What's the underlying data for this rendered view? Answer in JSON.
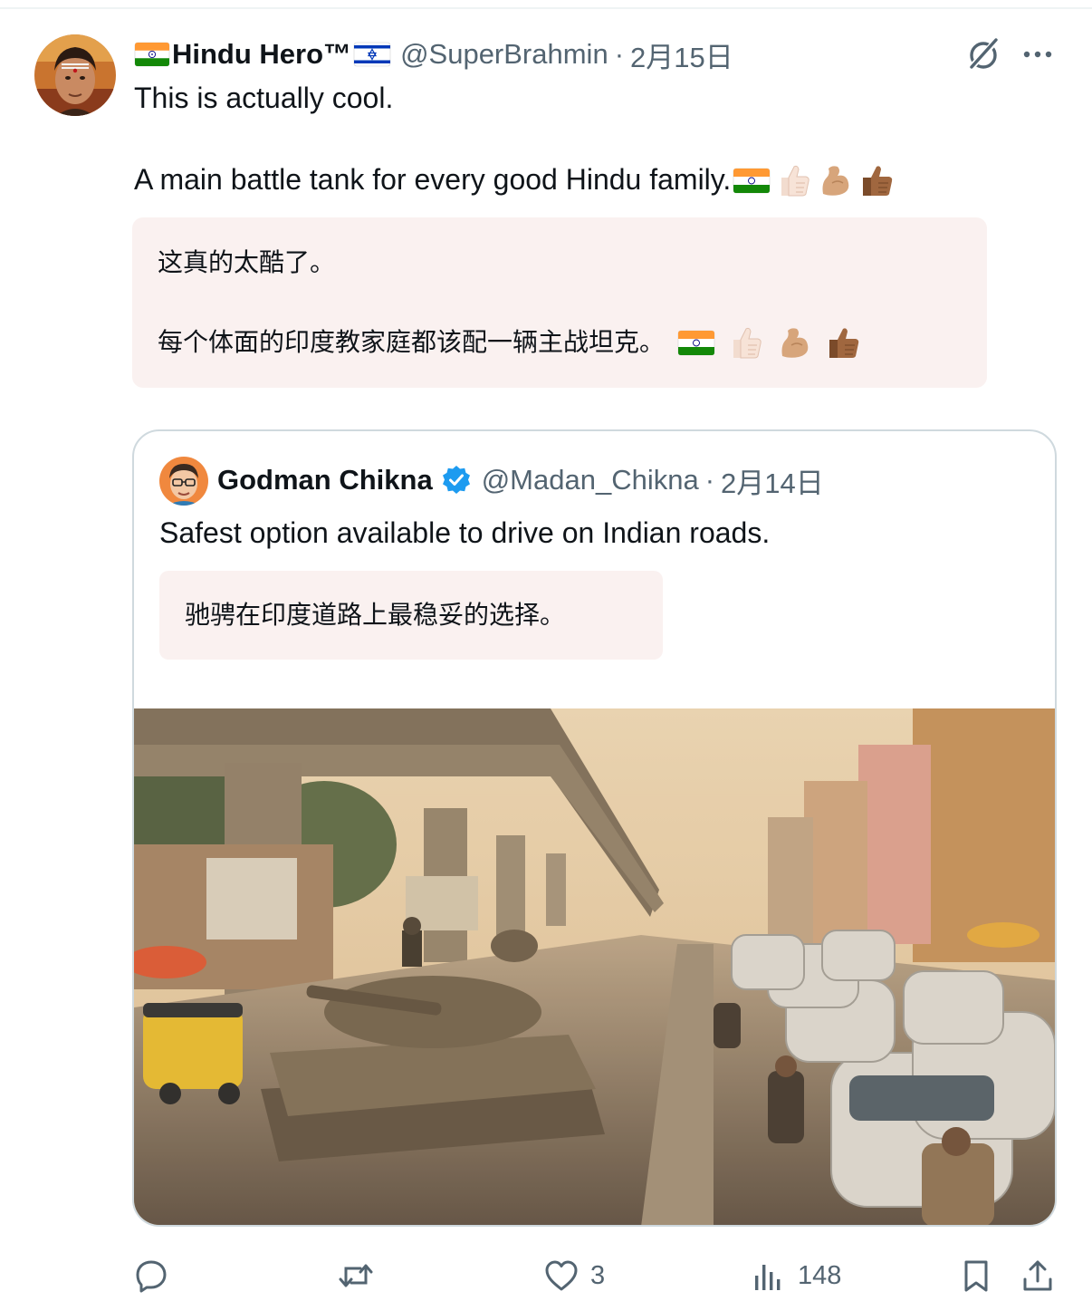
{
  "post": {
    "display_name": "Hindu Hero™",
    "handle": "@SuperBrahmin",
    "separator": "·",
    "date": "2月15日",
    "text_line1": "This is actually cool.",
    "text_line2": "A main battle tank for every good Hindu family.",
    "translation_line1": "这真的太酷了。",
    "translation_line2": "每个体面的印度教家庭都该配一辆主战坦克。",
    "icons": [
      "india-flag-icon",
      "israel-flag-icon",
      "grok-icon",
      "more-icon"
    ]
  },
  "quoted_post": {
    "display_name": "Godman Chikna",
    "handle": "@Madan_Chikna",
    "separator": "·",
    "date": "2月14日",
    "text": "Safest option available to drive on Indian roads.",
    "translation": "驰骋在印度道路上最稳妥的选择。",
    "verified": true,
    "verified_color": "#1d9bf0"
  },
  "actions": {
    "reply_count": "",
    "repost_count": "",
    "like_count": "3",
    "views_count": "148"
  },
  "colors": {
    "text_primary": "#0f1419",
    "text_secondary": "#536471",
    "translation_bg": "#faf1f0",
    "border": "#cfd9de"
  }
}
